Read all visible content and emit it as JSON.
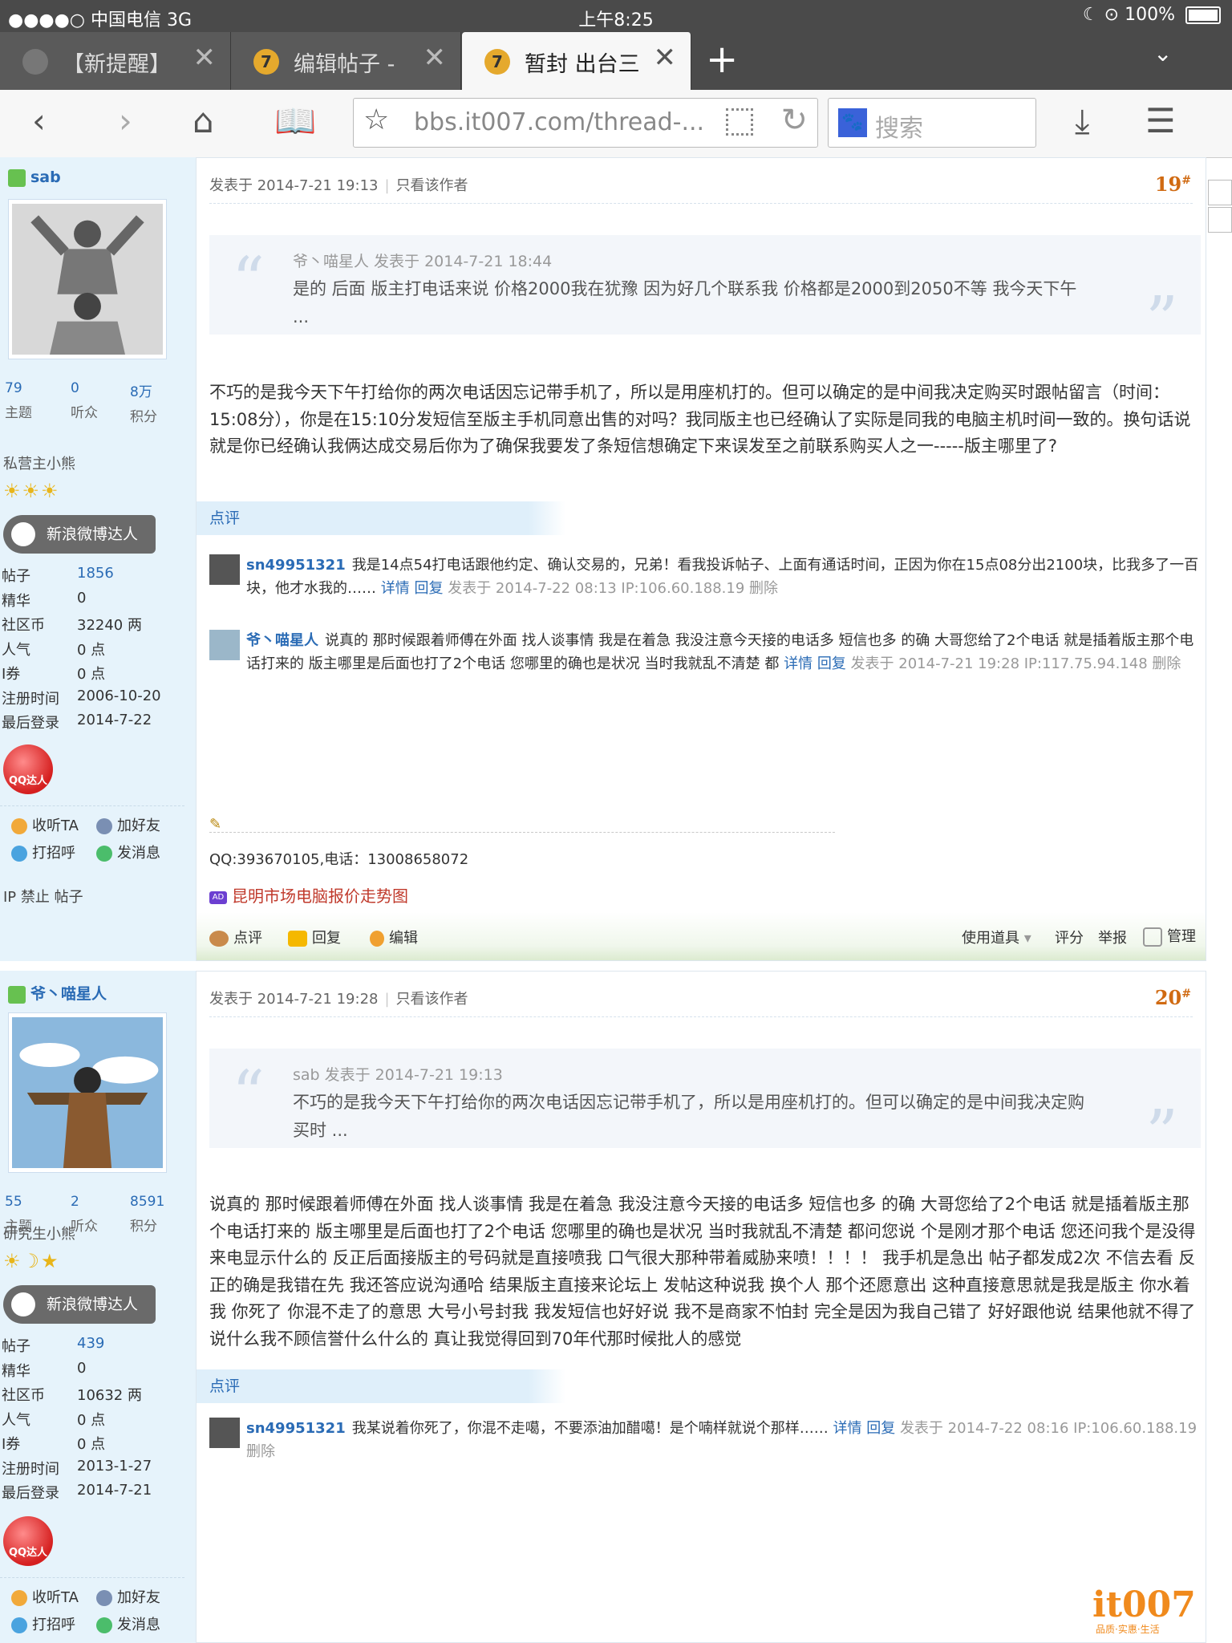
{
  "status": {
    "carrier": "●●●●○ 中国电信 3G",
    "time": "上午8:25",
    "battery": "100%"
  },
  "tabs": [
    {
      "label": "【新提醒】"
    },
    {
      "label": "编辑帖子 - "
    },
    {
      "label": "暂封 出台三"
    }
  ],
  "toolbar": {
    "url": "bbs.it007.com/thread-...",
    "search_placeholder": "搜索"
  },
  "posts": [
    {
      "user": {
        "name": "sab",
        "stats": [
          {
            "num": "79",
            "label": "主题"
          },
          {
            "num": "0",
            "label": "听众"
          },
          {
            "num": "8万",
            "label": "积分"
          }
        ],
        "rank": "私营主小熊",
        "stars": "☀☀☀",
        "weibo": "新浪微博达人",
        "info": [
          {
            "k": "帖子",
            "v": "1856"
          },
          {
            "k": "精华",
            "v": "0"
          },
          {
            "k": "社区币",
            "v": "32240 两"
          },
          {
            "k": "人气",
            "v": "0 点"
          },
          {
            "k": "I券",
            "v": "0 点"
          },
          {
            "k": "注册时间",
            "v": "2006-10-20"
          },
          {
            "k": "最后登录",
            "v": "2014-7-22"
          }
        ],
        "qq_badge": "QQ达人",
        "actions": [
          "收听TA",
          "加好友",
          "打招呼",
          "发消息"
        ],
        "ipban": "IP 禁止 帖子"
      },
      "posted": "发表于 2014-7-21 19:13",
      "only_author": "只看该作者",
      "floor": "19",
      "quote": {
        "head": "爷丶喵星人 发表于 2014-7-21 18:44",
        "body": "是的  后面  版主打电话来说  价格2000我在犹豫  因为好几个联系我  价格都是2000到2050不等  我今天下午 ..."
      },
      "body": "不巧的是我今天下午打给你的两次电话因忘记带手机了，所以是用座机打的。但可以确定的是中间我决定购买时跟帖留言（时间：15:08分），你是在15:10分发短信至版主手机同意出售的对吗？我同版主也已经确认了实际是同我的电脑主机时间一致的。换句话说就是你已经确认我俩达成交易后你为了确保我要发了条短信想确定下来误发至之前联系购买人之一-----版主哪里了?",
      "dianping": "点评",
      "comments": [
        {
          "name": "sn49951321",
          "text": "我是14点54打电话跟他约定、确认交易的，兄弟！看我投诉帖子、上面有通话时间，正因为你在15点08分出2100块，比我多了一百块，他才水我的……",
          "detail": "详情",
          "reply": "回复",
          "meta": "发表于 2014-7-22 08:13 IP:106.60.188.19",
          "delete": "删除"
        },
        {
          "name": "爷丶喵星人",
          "text": "说真的 那时候跟着师傅在外面 找人谈事情 我是在着急 我没注意今天接的电话多 短信也多 的确 大哥您给了2个电话 就是插着版主那个电话打来的 版主哪里是后面也打了2个电话 您哪里的确也是状况 当时我就乱不清楚 都",
          "detail": "详情",
          "reply": "回复",
          "meta": "发表于 2014-7-21 19:28 IP:117.75.94.148",
          "delete": "删除"
        }
      ],
      "signature": "QQ:393670105,电话：13008658072",
      "ad": "昆明市场电脑报价走势图",
      "footer": {
        "comment": "点评",
        "reply": "回复",
        "edit": "编辑",
        "tools": "使用道具",
        "rate": "评分",
        "report": "举报",
        "manage": "管理"
      }
    },
    {
      "user": {
        "name": "爷丶喵星人",
        "stats": [
          {
            "num": "55",
            "label": "主题"
          },
          {
            "num": "2",
            "label": "听众"
          },
          {
            "num": "8591",
            "label": "积分"
          }
        ],
        "rank": "研究生小熊",
        "stars": "☀☽★",
        "weibo": "新浪微博达人",
        "info": [
          {
            "k": "帖子",
            "v": "439"
          },
          {
            "k": "精华",
            "v": "0"
          },
          {
            "k": "社区币",
            "v": "10632 两"
          },
          {
            "k": "人气",
            "v": "0 点"
          },
          {
            "k": "I券",
            "v": "0 点"
          },
          {
            "k": "注册时间",
            "v": "2013-1-27"
          },
          {
            "k": "最后登录",
            "v": "2014-7-21"
          }
        ],
        "qq_badge": "QQ达人",
        "actions": [
          "收听TA",
          "加好友",
          "打招呼",
          "发消息"
        ]
      },
      "posted": "发表于 2014-7-21 19:28",
      "only_author": "只看该作者",
      "floor": "20",
      "quote": {
        "head": "sab 发表于 2014-7-21 19:13",
        "body": "不巧的是我今天下午打给你的两次电话因忘记带手机了，所以是用座机打的。但可以确定的是中间我决定购买时 ..."
      },
      "body": "说真的 那时候跟着师傅在外面  找人谈事情 我是在着急 我没注意今天接的电话多 短信也多 的确 大哥您给了2个电话 就是插着版主那个电话打来的  版主哪里是后面也打了2个电话 您哪里的确也是状况  当时我就乱不清楚 都问您说 个是刚才那个电话 您还问我个是没得来电显示什么的   反正后面接版主的号码就是直接喷我  口气很大那种带着威胁来喷！！！！ 我手机是急出  帖子都发成2次 不信去看 反正的确是我错在先 我还答应说沟通哈  结果版主直接来论坛上 发帖这种说我  换个人 那个还愿意出  这种直接意思就是我是版主 你水着我 你死了 你混不走了的意思 大号小号封我  我发短信也好好说 我不是商家不怕封 完全是因为我自己错了 好好跟他说 结果他就不得了 说什么我不顾信誉什么什么的  真让我觉得回到70年代那时候批人的感觉",
      "dianping": "点评",
      "comments": [
        {
          "name": "sn49951321",
          "text": "我某说着你死了，你混不走噶，不要添油加醋噶！是个喃样就说个那样……",
          "detail": "详情",
          "reply": "回复",
          "meta": "发表于 2014-7-22 08:16 IP:106.60.188.19",
          "delete": "删除"
        }
      ]
    }
  ],
  "watermark": {
    "logo": "it007",
    "tag": "品质·实惠·生活"
  }
}
